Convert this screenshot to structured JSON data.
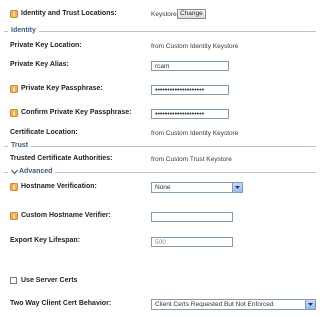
{
  "identity_trust": {
    "label": "Identity and Trust Locations:",
    "value": "Keystores",
    "change_button": "Change"
  },
  "sections": {
    "identity": "Identity",
    "trust": "Trust",
    "advanced": "Advanced"
  },
  "identity": {
    "private_key_location_label": "Private Key Location:",
    "private_key_location_value": "from Custom Identity Keystore",
    "private_key_alias_label": "Private Key Alias:",
    "private_key_alias_value": "rcam",
    "passphrase_label": "Private Key Passphrase:",
    "passphrase_value": "••••••••••••••••••••",
    "confirm_passphrase_label": "Confirm Private Key Passphrase:",
    "confirm_passphrase_value": "••••••••••••••••••••",
    "certificate_location_label": "Certificate Location:",
    "certificate_location_value": "from Custom Identity Keystore"
  },
  "trust": {
    "trusted_ca_label": "Trusted Certificate Authorities:",
    "trusted_ca_value": "from Custom Trust Keystore"
  },
  "advanced": {
    "hostname_verification_label": "Hostname Verification:",
    "hostname_verification_value": "None",
    "custom_verifier_label": "Custom Hostname Verifier:",
    "custom_verifier_value": "",
    "export_key_lifespan_label": "Export Key Lifespan:",
    "export_key_lifespan_value": "500",
    "use_server_certs_label": "Use Server Certs",
    "use_server_certs_checked": false,
    "two_way_label": "Two Way Client Cert Behavior:",
    "two_way_value": "Client Certs Requested But Not Enforced"
  },
  "colors": {
    "section_text": "#3d5a80",
    "input_border": "#7f9db9",
    "icon_orange": "#e8a23c"
  },
  "icons": {
    "info": "info-icon",
    "select_arrow": "chevron-down-icon",
    "section_toggle": "expand-chevron-icon"
  }
}
